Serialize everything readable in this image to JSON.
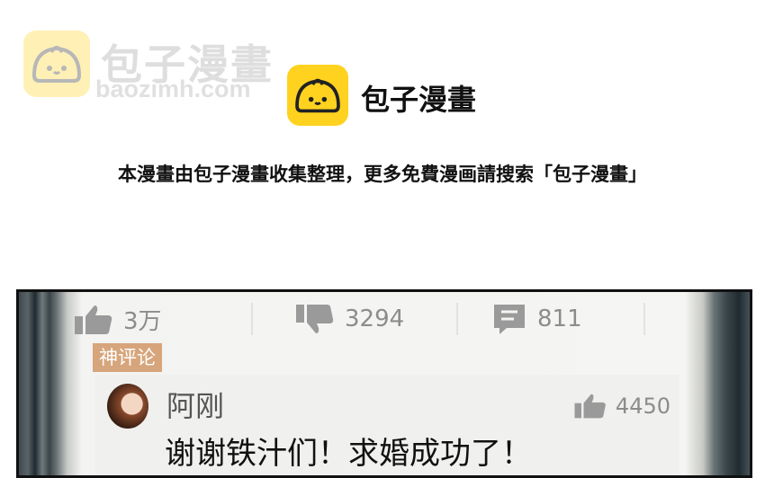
{
  "watermark": {
    "name": "包子漫畫",
    "url": "baozimh.com"
  },
  "brand": {
    "name": "包子漫畫"
  },
  "notice": "本漫畫由包子漫畫收集整理，更多免費漫画請搜索「包子漫畫」",
  "comic_panel": {
    "stats": {
      "likes": "3万",
      "dislikes": "3294",
      "comments": "811"
    },
    "tag": "神评论",
    "comment": {
      "author": "阿刚",
      "likes": "4450",
      "text": "谢谢铁汁们！求婚成功了！"
    }
  },
  "colors": {
    "logo_yellow": "#ffd21f",
    "tag_bg": "#d7a57c"
  }
}
